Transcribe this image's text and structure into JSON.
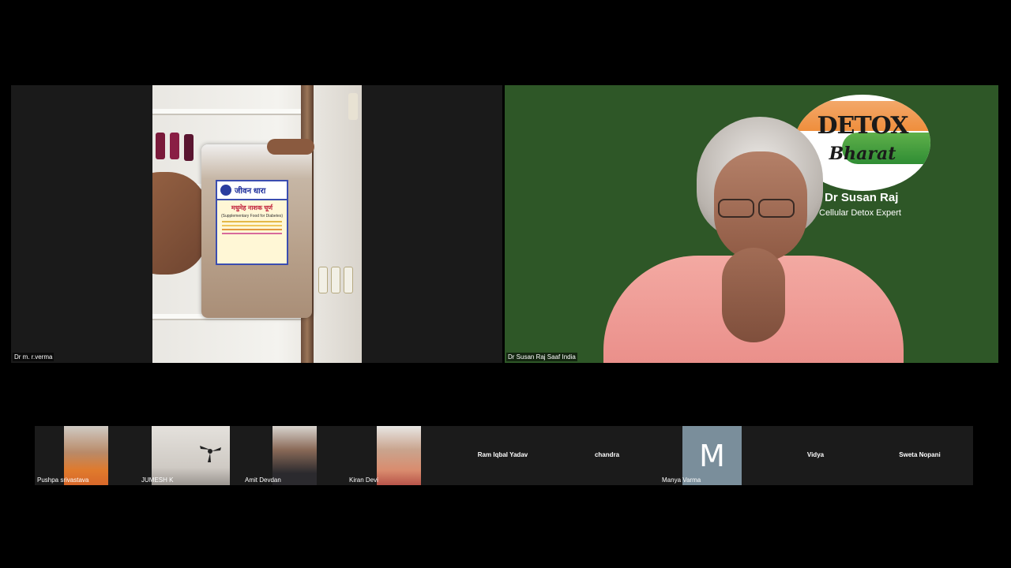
{
  "main_tiles": [
    {
      "name": "Dr m. r.verma"
    },
    {
      "name": "Dr Susan Raj Saaf India"
    }
  ],
  "packet_label": {
    "brand": "जीवन धारा",
    "product": "मधुमेह नाशक चूर्ण",
    "subtitle": "(Supplementary Food for Diabetes)"
  },
  "background_logo": {
    "line1": "DETOX",
    "line2": "Bharat",
    "speaker_name": "Dr Susan Raj",
    "speaker_role": "Cellular Detox Expert"
  },
  "participants": [
    {
      "name": "Pushpa srivastava",
      "type": "video"
    },
    {
      "name": "JUMESH K",
      "type": "video"
    },
    {
      "name": "Amit Devdan",
      "type": "video"
    },
    {
      "name": "Kiran Devi",
      "type": "video"
    },
    {
      "name": "Ram Iqbal Yadav",
      "type": "name-only"
    },
    {
      "name": "chandra",
      "type": "name-only"
    },
    {
      "name": "Manya Varma",
      "type": "avatar",
      "initial": "M"
    },
    {
      "name": "Vidya",
      "type": "name-only"
    },
    {
      "name": "Sweta Nopani",
      "type": "name-only"
    }
  ],
  "colors": {
    "background": "#000000",
    "virtual_bg_green": "#2e5727",
    "avatar_bg": "#7a8e9b",
    "strip_bg": "#1b1b1b"
  }
}
